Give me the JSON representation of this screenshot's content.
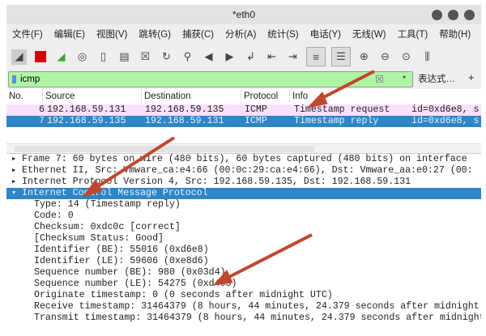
{
  "window": {
    "title": "*eth0"
  },
  "menu": [
    "文件(F)",
    "编辑(E)",
    "视图(V)",
    "跳转(G)",
    "捕获(C)",
    "分析(A)",
    "统计(S)",
    "电话(Y)",
    "无线(W)",
    "工具(T)",
    "帮助(H)"
  ],
  "toolbar_icons": [
    "shark-fin-icon",
    "stop-icon",
    "restart-icon",
    "options-gear-icon",
    "open-icon",
    "save-icon",
    "close-file-icon",
    "reload-icon",
    "find-icon",
    "back-icon",
    "forward-icon",
    "goto-icon",
    "first-icon",
    "last-icon",
    "autoscroll-icon",
    "colorize-icon",
    "zoom-in-icon",
    "zoom-out-icon",
    "zoom-reset-icon",
    "resize-columns-icon"
  ],
  "filter": {
    "value": "icmp",
    "expression_label": "表达式…",
    "plus_label": "+"
  },
  "columns": [
    "No.",
    "Source",
    "Destination",
    "Protocol",
    "Info"
  ],
  "packets": [
    {
      "no": "6",
      "source": "192.168.59.131",
      "destination": "192.168.59.135",
      "protocol": "ICMP",
      "info": "Timestamp request",
      "extra": "id=0xd6e8, s"
    },
    {
      "no": "7",
      "source": "192.168.59.135",
      "destination": "192.168.59.131",
      "protocol": "ICMP",
      "info": "Timestamp reply",
      "extra": "id=0xd6e8, s"
    }
  ],
  "details": [
    "Frame 7: 60 bytes on wire (480 bits), 60 bytes captured (480 bits) on interface",
    "Ethernet II, Src: Vmware_ca:e4:66 (00:0c:29:ca:e4:66), Dst: Vmware_aa:e0:27 (00:",
    "Internet Protocol Version 4, Src: 192.168.59.135, Dst: 192.168.59.131",
    "Internet Control Message Protocol",
    "Type: 14 (Timestamp reply)",
    "Code: 0",
    "Checksum: 0xdc0c [correct]",
    "[Checksum Status: Good]",
    "Identifier (BE): 55016 (0xd6e8)",
    "Identifier (LE): 59606 (0xe8d6)",
    "Sequence number (BE): 980 (0x03d4)",
    "Sequence number (LE): 54275 (0xd403)",
    "Originate timestamp: 0 (0 seconds after midnight UTC)",
    "Receive timestamp: 31464379 (8 hours, 44 minutes, 24.379 seconds after midnight",
    "Transmit timestamp: 31464379 (8 hours, 44 minutes, 24.379 seconds after midnight"
  ],
  "colors": {
    "filter_bg": "#aff5a5",
    "selected": "#2f86c6",
    "request_row": "#fce0ff",
    "arrow": "#c0472e"
  }
}
